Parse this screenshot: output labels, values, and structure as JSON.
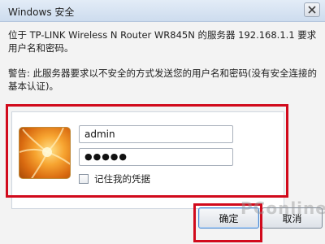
{
  "window": {
    "title": "Windows 安全"
  },
  "message": {
    "line1": "位于 TP-LINK Wireless N Router WR845N 的服务器 192.168.1.1 要求用户名和密码。",
    "warning": "警告: 此服务器要求以不安全的方式发送您的用户名和密码(没有安全连接的基本认证)。"
  },
  "credentials": {
    "username": "admin",
    "password_mask": "●●●●●",
    "remember_label": "记住我的凭据"
  },
  "buttons": {
    "ok": "确定",
    "cancel": "取消"
  },
  "watermark": "PConline",
  "colors": {
    "highlight": "#d10a1c"
  }
}
